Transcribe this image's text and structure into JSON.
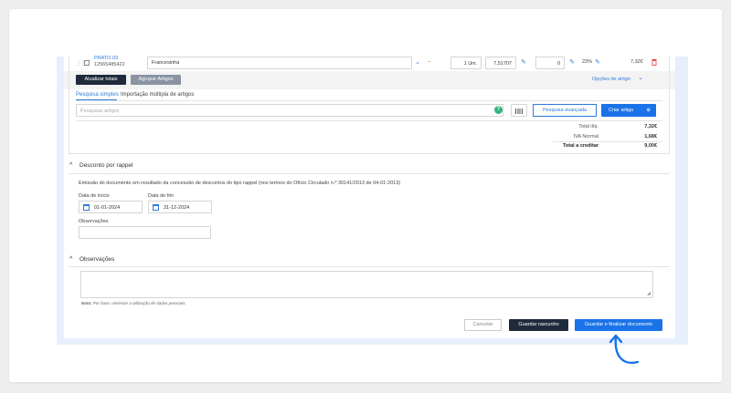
{
  "line": {
    "code": "PRATO.03",
    "barcode": "12565485422",
    "description": "Francesinha",
    "dash": "--",
    "quantity": "1 Uni.",
    "price": "7,51707",
    "discount": "0",
    "tax": "23%",
    "total": "7,32€"
  },
  "actions": {
    "update_totals": "Atualizar totais",
    "group_items": "Agrupar Artigos",
    "item_options": "Opções de artigo"
  },
  "tabs": [
    {
      "label": "Pesquisa simples"
    },
    {
      "label": "Importação múltipla de artigos"
    }
  ],
  "search": {
    "placeholder": "Pesquisar artigos",
    "help": "?",
    "advanced": "Pesquisa avançada",
    "create": "Criar artigo"
  },
  "totals": [
    {
      "label": "Total ilíq.",
      "value": "7,32€"
    },
    {
      "label": "IVA Normal",
      "value": "1,68€"
    },
    {
      "label": "Total a creditar",
      "value": "9,00€"
    }
  ],
  "rappel": {
    "title": "Desconto por rappel",
    "text": "Emissão do documento em resultado da concessão de descontos do tipo rappel (nos termos do Ofício Circulado n.º 30141/2013 de 04-01-2013)",
    "start_label": "Data de início",
    "start_value": "01-01-2024",
    "end_label": "Data de fim",
    "end_value": "31-12-2024",
    "obs_label": "Observações"
  },
  "observations": {
    "title": "Observações",
    "note_bold": "Nota:",
    "note_text": " Por favor, minimize a utilização de dados pessoais."
  },
  "footer": {
    "cancel": "Cancelar",
    "save_draft": "Guardar rascunho",
    "save_finalize": "Guardar e finalizar documento"
  },
  "colors": {
    "accent": "#1a73e8",
    "dark_button": "#1f2a3c",
    "delete": "#e53935"
  }
}
